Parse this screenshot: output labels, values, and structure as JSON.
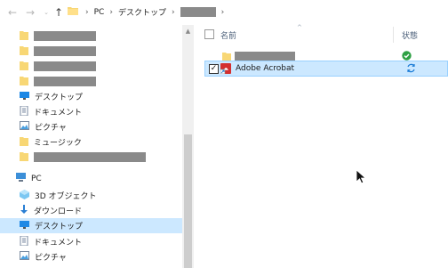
{
  "address_bar": {
    "breadcrumbs": [
      "PC",
      "デスクトップ"
    ],
    "redacted_segment": ""
  },
  "nav_pane": {
    "items": [
      {
        "label": "",
        "icon": "folder-icon",
        "redacted": true
      },
      {
        "label": "",
        "icon": "folder-icon",
        "redacted": true
      },
      {
        "label": "",
        "icon": "folder-icon",
        "redacted": true
      },
      {
        "label": "",
        "icon": "folder-icon",
        "redacted": true
      },
      {
        "label": "デスクトップ",
        "icon": "desktop-icon"
      },
      {
        "label": "ドキュメント",
        "icon": "documents-icon"
      },
      {
        "label": "ピクチャ",
        "icon": "pictures-icon"
      },
      {
        "label": "ミュージック",
        "icon": "music-icon"
      },
      {
        "label": "",
        "icon": "folder-icon",
        "redacted": true
      },
      {
        "label": "PC",
        "icon": "pc-icon"
      },
      {
        "label": "3D オブジェクト",
        "icon": "3d-objects-icon"
      },
      {
        "label": "ダウンロード",
        "icon": "downloads-icon"
      },
      {
        "label": "デスクトップ",
        "icon": "desktop-icon",
        "selected": true
      },
      {
        "label": "ドキュメント",
        "icon": "documents-icon"
      },
      {
        "label": "ピクチャ",
        "icon": "pictures-icon"
      }
    ]
  },
  "content": {
    "columns": {
      "name": "名前",
      "status": "状態"
    },
    "rows": [
      {
        "name": "",
        "icon": "folder-icon",
        "status_icon": "synced-check-icon",
        "redacted": true
      },
      {
        "name": "Adobe Acrobat",
        "icon": "pdf-shortcut-icon",
        "status_icon": "sync-pending-icon",
        "selected": true,
        "checked": true
      }
    ]
  },
  "colors": {
    "selection": "#cce8ff",
    "selection_border": "#99d1ff",
    "folder": "#f8d775",
    "sync_ok": "#2ea043",
    "sync_pending": "#1c7cd6",
    "redaction": "#8a8a8a"
  }
}
